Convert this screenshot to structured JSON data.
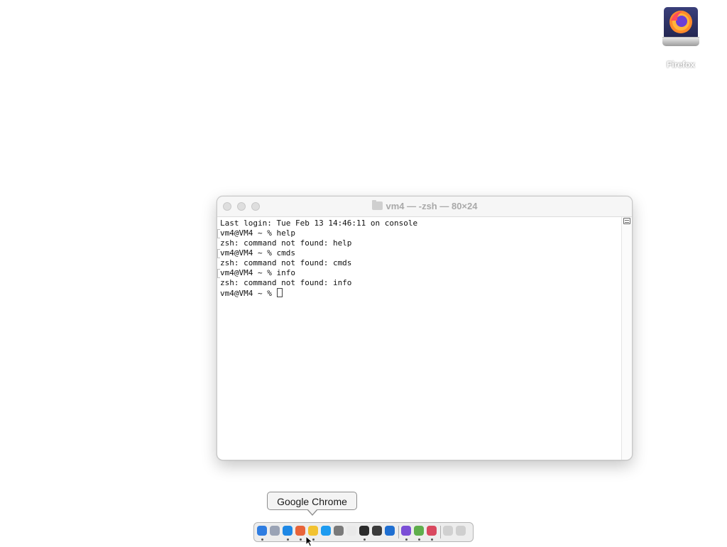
{
  "desktop": {
    "icons": [
      {
        "label": "Firefox",
        "icon": "firefox-drive-icon"
      }
    ]
  },
  "terminal": {
    "title": "vm4 — -zsh — 80×24",
    "lines": [
      "Last login: Tue Feb 13 14:46:11 on console",
      "vm4@VM4 ~ % help",
      "zsh: command not found: help",
      "vm4@VM4 ~ % cmds",
      "zsh: command not found: cmds",
      "vm4@VM4 ~ % info",
      "zsh: command not found: info",
      "vm4@VM4 ~ % "
    ]
  },
  "tooltip": {
    "text": "Google Chrome"
  },
  "dock": {
    "items": [
      {
        "name": "finder-icon",
        "color": "#2f7de1",
        "running": true
      },
      {
        "name": "launchpad-icon",
        "color": "#9aa3b5",
        "running": false
      },
      {
        "name": "safari-icon",
        "color": "#1e88e5",
        "running": true
      },
      {
        "name": "firefox-icon",
        "color": "#e8643a",
        "running": true
      },
      {
        "name": "chrome-icon",
        "color": "#f2c230",
        "running": true
      },
      {
        "name": "app-store-icon",
        "color": "#1d9bf0",
        "running": false
      },
      {
        "name": "system-settings-icon",
        "color": "#7a7a7a",
        "running": false
      },
      {
        "name": "textedit-icon",
        "color": "#e9e9e9",
        "running": false
      },
      {
        "name": "terminal-icon",
        "color": "#2b2b2b",
        "running": true
      },
      {
        "name": "app-icon-1",
        "color": "#3b3b3b",
        "running": false
      },
      {
        "name": "vscode-icon",
        "color": "#1f6fd1",
        "running": false
      },
      {
        "name": "app-icon-2",
        "color": "#7b4fd6",
        "running": true
      },
      {
        "name": "app-icon-3",
        "color": "#5fae4c",
        "running": true
      },
      {
        "name": "firefox-alt-icon",
        "color": "#d9485f",
        "running": true
      },
      {
        "name": "downloads-icon",
        "color": "#d0d0d0",
        "running": false
      },
      {
        "name": "trash-icon",
        "color": "#cfcfcf",
        "running": false
      }
    ]
  }
}
